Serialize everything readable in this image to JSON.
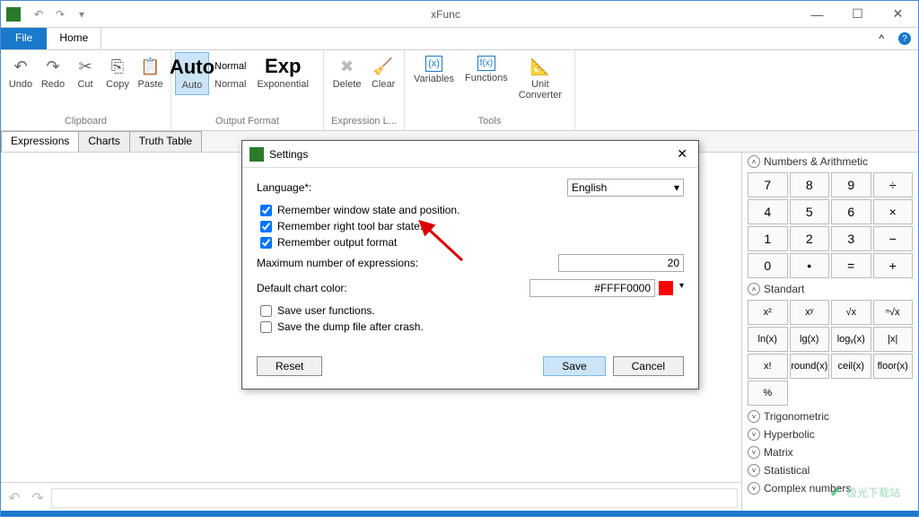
{
  "window": {
    "title": "xFunc"
  },
  "menubar": {
    "file": "File",
    "home": "Home"
  },
  "ribbon": {
    "clipboard": {
      "label": "Clipboard",
      "undo": "Undo",
      "redo": "Redo",
      "cut": "Cut",
      "copy": "Copy",
      "paste": "Paste"
    },
    "output": {
      "label": "Output Format",
      "auto_big": "Auto",
      "auto": "Auto",
      "normal_big": "Normal",
      "normal": "Normal",
      "exp_big": "Exp",
      "exp": "Exponential"
    },
    "expr": {
      "label": "Expression L...",
      "delete": "Delete",
      "clear": "Clear"
    },
    "tools": {
      "label": "Tools",
      "variables": "Variables",
      "functions": "Functions",
      "unit": "Unit\nConverter"
    }
  },
  "tabs": {
    "expressions": "Expressions",
    "charts": "Charts",
    "truth": "Truth Table"
  },
  "side": {
    "numbers_hdr": "Numbers & Arithmetic",
    "grid1": [
      "7",
      "8",
      "9",
      "÷",
      "4",
      "5",
      "6",
      "×",
      "1",
      "2",
      "3",
      "−",
      "0",
      "•",
      "=",
      "+"
    ],
    "standart_hdr": "Standart",
    "grid2": [
      "x²",
      "xʸ",
      "√x",
      "ⁿ√x",
      "ln(x)",
      "lg(x)",
      "logᵧ(x)",
      "|x|",
      "x!",
      "round(x)",
      "ceil(x)",
      "floor(x)",
      "%",
      "",
      "",
      ""
    ],
    "sections": [
      "Trigonometric",
      "Hyperbolic",
      "Matrix",
      "Statistical",
      "Complex numbers"
    ]
  },
  "dialog": {
    "title": "Settings",
    "language_lbl": "Language*:",
    "language_val": "English",
    "chk1": "Remember window state and position.",
    "chk2": "Remember right tool bar state.",
    "chk3": "Remember output format",
    "max_lbl": "Maximum number of expressions:",
    "max_val": "20",
    "color_lbl": "Default chart color:",
    "color_val": "#FFFF0000",
    "chk4": "Save user functions.",
    "chk5": "Save the dump file after crash.",
    "reset": "Reset",
    "save": "Save",
    "cancel": "Cancel"
  },
  "watermark": "极光下载站"
}
